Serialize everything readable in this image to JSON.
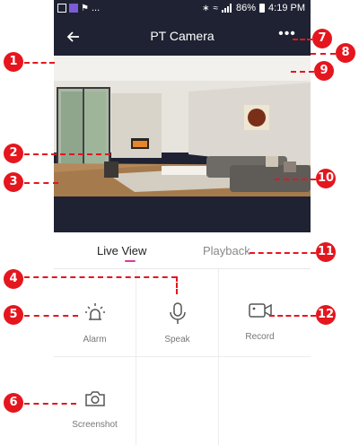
{
  "status_bar": {
    "battery": "86%",
    "time": "4:19 PM",
    "notif_more": "..."
  },
  "header": {
    "title": "PT Camera"
  },
  "tabs": [
    {
      "label": "Live View",
      "active": true
    },
    {
      "label": "Playback",
      "active": false
    }
  ],
  "actions": [
    {
      "label": "Alarm",
      "icon": "alarm-light-icon"
    },
    {
      "label": "Speak",
      "icon": "microphone-icon"
    },
    {
      "label": "Record",
      "icon": "video-camera-icon"
    },
    {
      "label": "Screenshot",
      "icon": "camera-icon"
    }
  ],
  "annotations": [
    "1",
    "2",
    "3",
    "4",
    "5",
    "6",
    "7",
    "8",
    "9",
    "10",
    "11",
    "12"
  ],
  "colors": {
    "header_bg": "#1e2233",
    "accent": "#e0389b",
    "annotation": "#e5161e"
  }
}
